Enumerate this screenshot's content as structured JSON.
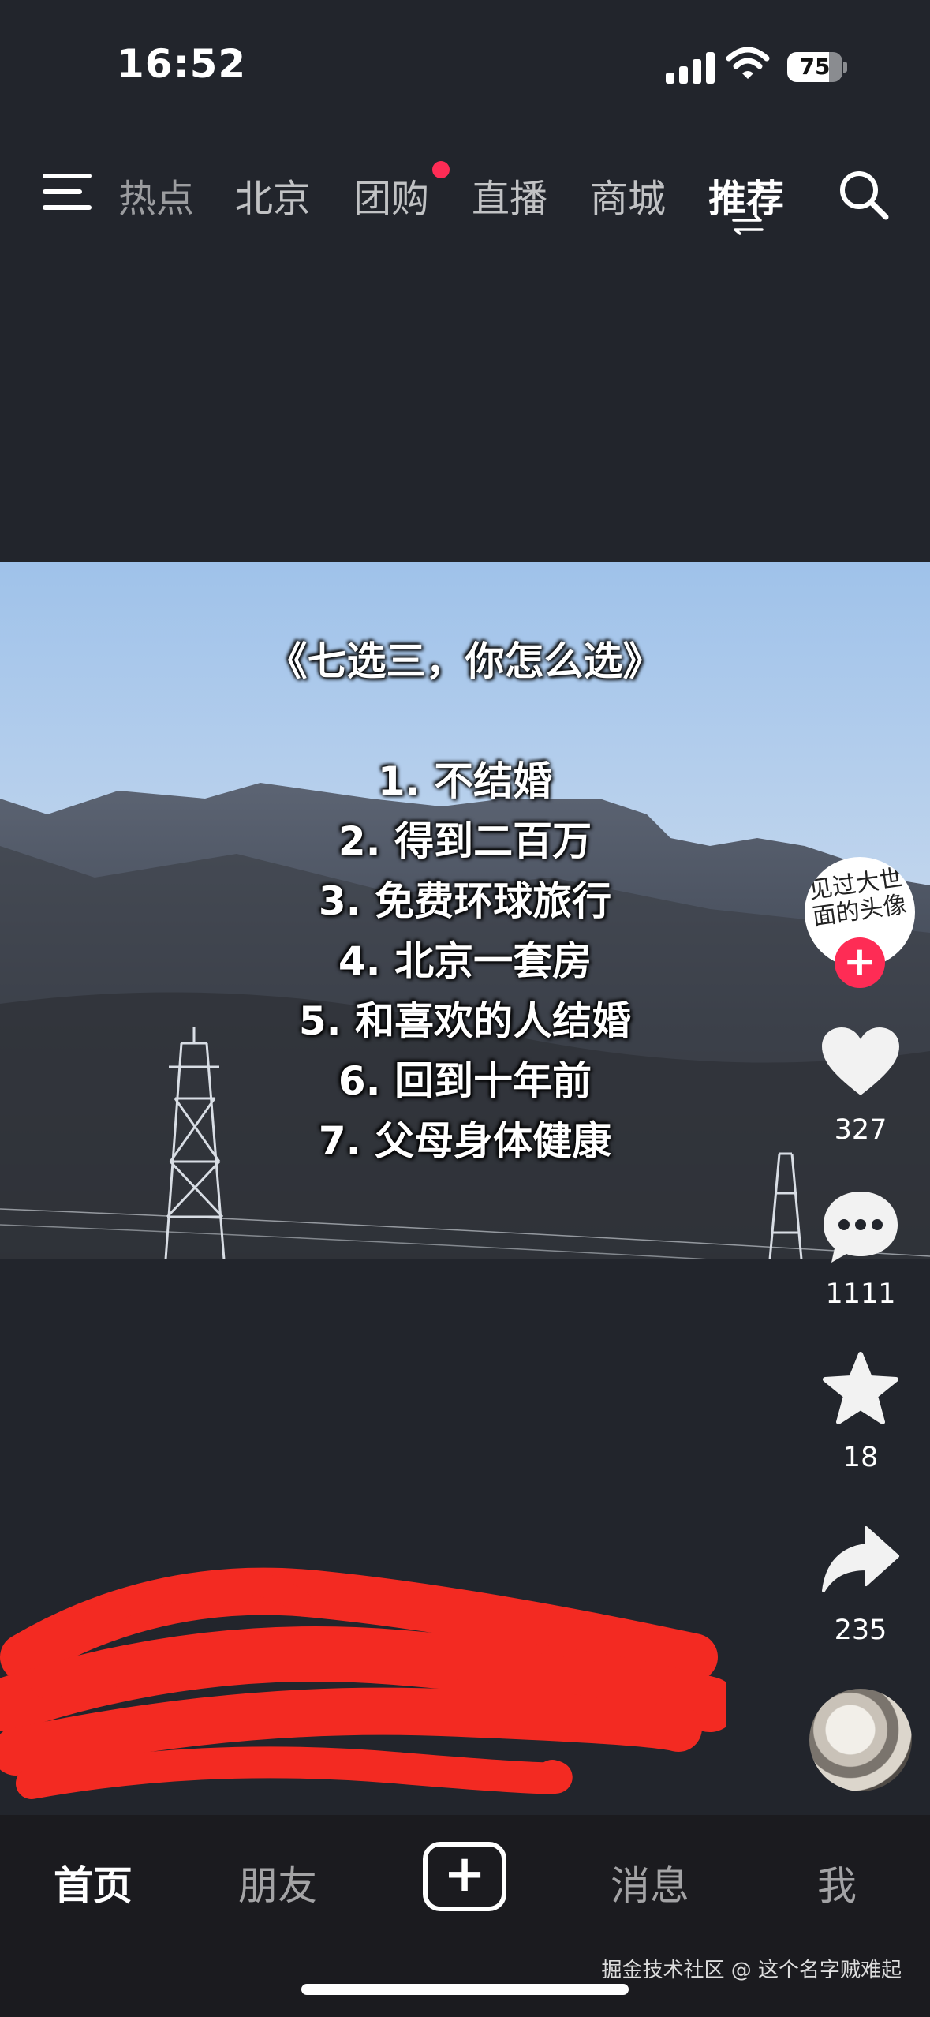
{
  "status_bar": {
    "time": "16:52",
    "battery": "75",
    "battery_level": 0.75
  },
  "top_nav": {
    "tabs": [
      {
        "label": "热点"
      },
      {
        "label": "北京"
      },
      {
        "label": "团购"
      },
      {
        "label": "直播"
      },
      {
        "label": "商城"
      },
      {
        "label": "推荐"
      }
    ],
    "active_tab": "推荐",
    "notification_dot_on": "团购"
  },
  "video": {
    "title": "《七选三，你怎么选》",
    "options": [
      "1. 不结婚",
      "2. 得到二百万",
      "3. 免费环球旅行",
      "4. 北京一套房",
      "5. 和喜欢的人结婚",
      "6. 回到十年前",
      "7. 父母身体健康"
    ]
  },
  "author": {
    "avatar_text": "见过大世面的头像"
  },
  "actions": {
    "likes": "327",
    "comments": "1111",
    "favorites": "18",
    "shares": "235"
  },
  "bottom_nav": {
    "home": "首页",
    "friends": "朋友",
    "messages": "消息",
    "me": "我"
  },
  "watermark": "掘金技术社区 @ 这个名字贼难起",
  "colors": {
    "accent": "#fe2c55",
    "background": "#22252c",
    "tabbar": "#1b1b1f",
    "redaction": "#ff2b22"
  }
}
